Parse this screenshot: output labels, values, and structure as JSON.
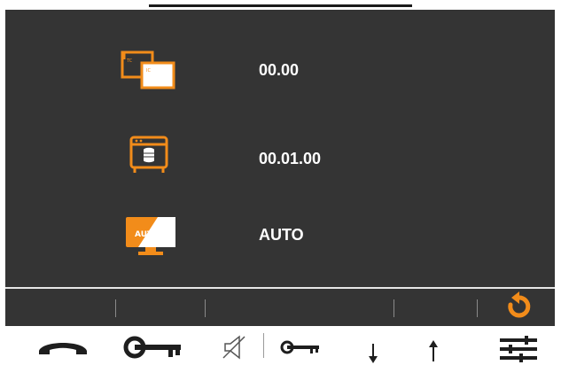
{
  "screen": {
    "rows": [
      {
        "icon": "picture-in-picture-icon",
        "value": "00.00"
      },
      {
        "icon": "browser-database-icon",
        "value": "00.01.00"
      },
      {
        "icon": "monitor-auto-icon",
        "value": "AUTO"
      }
    ],
    "monitor_badge": "AUTO"
  },
  "soft_bar": {
    "action_icon": "refresh-icon"
  },
  "bottom_bar": {
    "buttons": [
      {
        "icon": "handset-icon"
      },
      {
        "icon": "key-icon"
      },
      {
        "icon": "speaker-muted-icon"
      },
      {
        "icon": "key-small-icon"
      },
      {
        "icon": "arrow-down-icon"
      },
      {
        "icon": "arrow-up-icon"
      },
      {
        "icon": "settings-sliders-icon"
      }
    ]
  },
  "colors": {
    "screen_bg": "#343434",
    "accent": "#f28c1a",
    "icon_dark": "#1e1e1e"
  }
}
